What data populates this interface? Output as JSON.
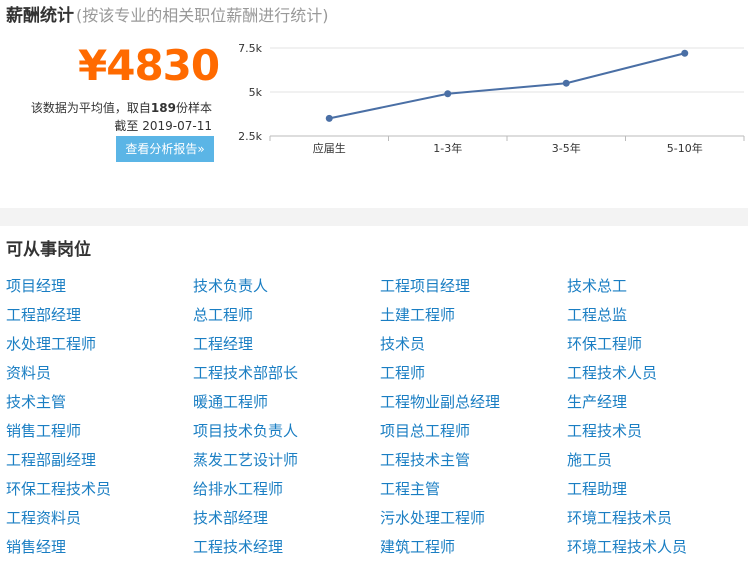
{
  "salary": {
    "title": "薪酬统计",
    "subtitle": "(按该专业的相关职位薪酬进行统计)",
    "amount": "¥4830",
    "sample_prefix": "该数据为平均值，取自",
    "sample_count": "189",
    "sample_suffix": "份样本",
    "date_prefix": "截至",
    "date": "2019-07-11",
    "report_button": "查看分析报告»"
  },
  "chart_data": {
    "type": "line",
    "categories": [
      "应届生",
      "1-3年",
      "3-5年",
      "5-10年"
    ],
    "values": [
      3500,
      4900,
      5500,
      7200
    ],
    "yticks": [
      2500,
      5000,
      7500
    ],
    "ytick_labels": [
      "2.5k",
      "5k",
      "7.5k"
    ],
    "ylim": [
      2500,
      7500
    ],
    "grid": true,
    "line_color": "#4a6fa5"
  },
  "jobs": {
    "title": "可从事岗位",
    "items": [
      "项目经理",
      "技术负责人",
      "工程项目经理",
      "技术总工",
      "工程部经理",
      "总工程师",
      "土建工程师",
      "工程总监",
      "水处理工程师",
      "工程经理",
      "技术员",
      "环保工程师",
      "资料员",
      "工程技术部部长",
      "工程师",
      "工程技术人员",
      "技术主管",
      "暖通工程师",
      "工程物业副总经理",
      "生产经理",
      "销售工程师",
      "项目技术负责人",
      "项目总工程师",
      "工程技术员",
      "工程部副经理",
      "蒸发工艺设计师",
      "工程技术主管",
      "施工员",
      "环保工程技术员",
      "给排水工程师",
      "工程主管",
      "工程助理",
      "工程资料员",
      "技术部经理",
      "污水处理工程师",
      "环境工程技术员",
      "销售经理",
      "工程技术经理",
      "建筑工程师",
      "环境工程技术人员"
    ]
  }
}
